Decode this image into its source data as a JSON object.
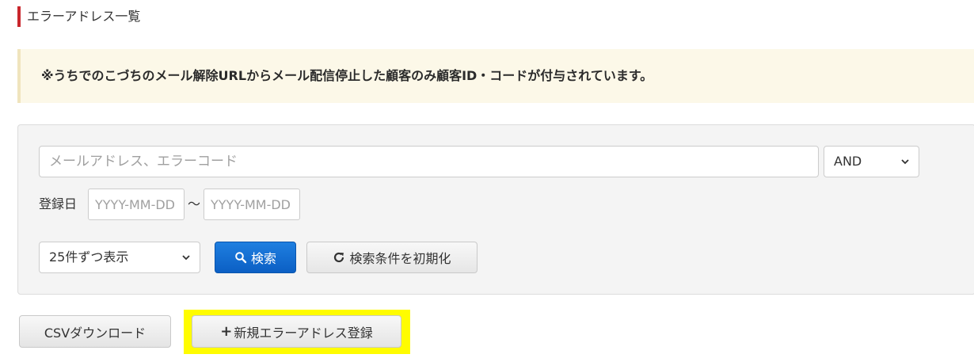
{
  "page": {
    "title": "エラーアドレス一覧"
  },
  "notice": {
    "text": "※うちでのこづちのメール解除URLからメール配信停止した顧客のみ顧客ID・コードが付与されています。",
    "bg_color": "#fcf8e8"
  },
  "search": {
    "keyword_placeholder": "メールアドレス、エラーコード",
    "keyword_value": "",
    "operator_selected": "AND",
    "date_label": "登録日",
    "date_from_placeholder": "YYYY-MM-DD",
    "date_to_placeholder": "YYYY-MM-DD",
    "date_separator": "～",
    "per_page_selected": "25件ずつ表示",
    "search_button": "検索",
    "search_icon": "search-icon",
    "reset_button": "検索条件を初期化",
    "reset_icon": "refresh-icon"
  },
  "actions": {
    "csv_button": "CSVダウンロード",
    "new_button_plus": "+",
    "new_button": "新規エラーアドレス登録",
    "highlight_color": "#fffc00"
  },
  "colors": {
    "accent_red": "#c9262c",
    "primary_blue": "#0b5fc4"
  }
}
